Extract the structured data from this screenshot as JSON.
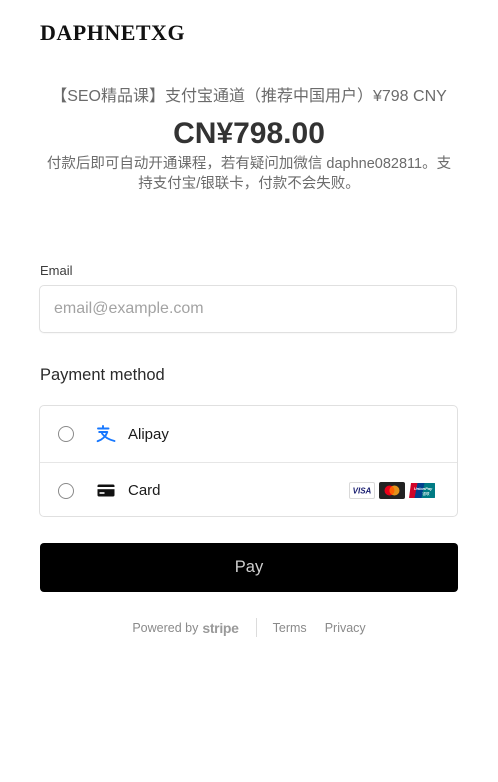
{
  "merchant": {
    "name": "DAPHNETXG"
  },
  "summary": {
    "product_name": "【SEO精品课】支付宝通道（推荐中国用户）¥798 CNY",
    "amount": "CN¥798.00",
    "description": "付款后即可自动开通课程，若有疑问加微信 daphne082811。支持支付宝/银联卡，付款不会失败。"
  },
  "email": {
    "label": "Email",
    "placeholder": "email@example.com",
    "value": ""
  },
  "payment_method": {
    "label": "Payment method",
    "options": [
      {
        "label": "Alipay",
        "icon": "alipay-icon",
        "selected": false
      },
      {
        "label": "Card",
        "icon": "card-icon",
        "selected": false,
        "brands": [
          "VISA",
          "mastercard",
          "UnionPay"
        ]
      }
    ]
  },
  "pay_button": {
    "label": "Pay"
  },
  "footer": {
    "powered_by": "Powered by",
    "stripe": "stripe",
    "terms": "Terms",
    "privacy": "Privacy"
  },
  "colors": {
    "alipay_blue": "#1677ff",
    "button_bg": "#000000",
    "visa_blue": "#1a1f71",
    "mastercard_red": "#eb001b",
    "mastercard_orange": "#f79e1b",
    "unionpay_red": "#d10429",
    "unionpay_blue": "#01418e",
    "unionpay_green": "#007b84"
  }
}
